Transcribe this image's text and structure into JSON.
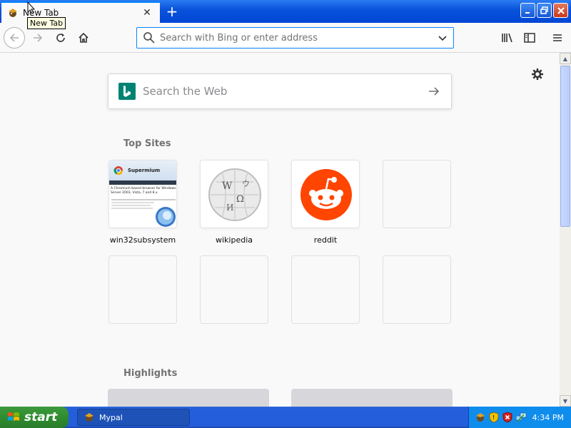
{
  "window": {
    "tab_title": "New Tab",
    "tooltip": "New Tab",
    "new_tab_symbol": "+",
    "tab_close_symbol": "✕"
  },
  "toolbar": {
    "address_placeholder": "Search with Bing or enter address"
  },
  "content": {
    "web_search_placeholder": "Search the Web",
    "top_sites_title": "Top Sites",
    "highlights_title": "Highlights",
    "top_sites": [
      {
        "label": "win32subsystem",
        "thumbnail": "supermium-screenshot"
      },
      {
        "label": "wikipedia",
        "thumbnail": "wikipedia-globe-icon"
      },
      {
        "label": "reddit",
        "thumbnail": "reddit-alien-icon"
      },
      {
        "label": "",
        "thumbnail": "empty"
      }
    ],
    "thumbnail_text": {
      "site_name": "Supermium",
      "headline": "A Chromium based browser for Windows",
      "subline": "Server 2003, Vista, 7 and 8.x"
    },
    "empty_tiles_row2": 4
  },
  "taskbar": {
    "start_label": "start",
    "task_item": "Mypal",
    "clock": "4:34 PM"
  },
  "colors": {
    "accent": "#0a84ff",
    "bing": "#008373",
    "reddit": "#ff4500",
    "xp_blue": "#245edb",
    "xp_green": "#2f8c2f"
  }
}
